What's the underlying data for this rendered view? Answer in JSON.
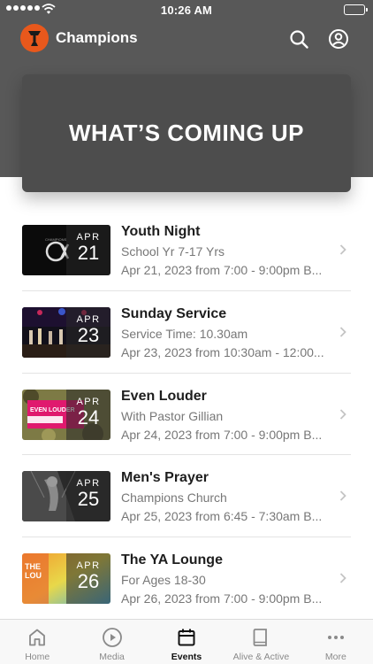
{
  "status_bar": {
    "time": "10:26 AM"
  },
  "header": {
    "app_name": "Champions"
  },
  "hero": {
    "title": "WHAT’S COMING UP"
  },
  "events": [
    {
      "title": "Youth Night",
      "subtitle": "School Yr 7-17 Yrs",
      "when": "Apr 21, 2023 from 7:00 - 9:00pm B...",
      "month": "APR",
      "day": "21"
    },
    {
      "title": "Sunday Service",
      "subtitle": "Service Time: 10.30am",
      "when": "Apr 23, 2023 from 10:30am - 12:00...",
      "month": "APR",
      "day": "23"
    },
    {
      "title": "Even Louder",
      "subtitle": "With Pastor Gillian",
      "when": "Apr 24, 2023 from 7:00 - 9:00pm B...",
      "month": "APR",
      "day": "24"
    },
    {
      "title": "Men's Prayer",
      "subtitle": "Champions Church",
      "when": "Apr 25, 2023 from 6:45 - 7:30am B...",
      "month": "APR",
      "day": "25"
    },
    {
      "title": "The YA Lounge",
      "subtitle": "For Ages 18-30",
      "when": "Apr 26, 2023 from 7:00 - 9:00pm B...",
      "month": "APR",
      "day": "26"
    }
  ],
  "tabs": [
    {
      "label": "Home",
      "icon": "home-icon"
    },
    {
      "label": "Media",
      "icon": "play-icon"
    },
    {
      "label": "Events",
      "icon": "calendar-icon",
      "active": true
    },
    {
      "label": "Alive & Active",
      "icon": "book-icon"
    },
    {
      "label": "More",
      "icon": "more-icon"
    }
  ],
  "colors": {
    "header": "#585858",
    "brand": "#e8581c",
    "hero": "#4d4d4d"
  }
}
